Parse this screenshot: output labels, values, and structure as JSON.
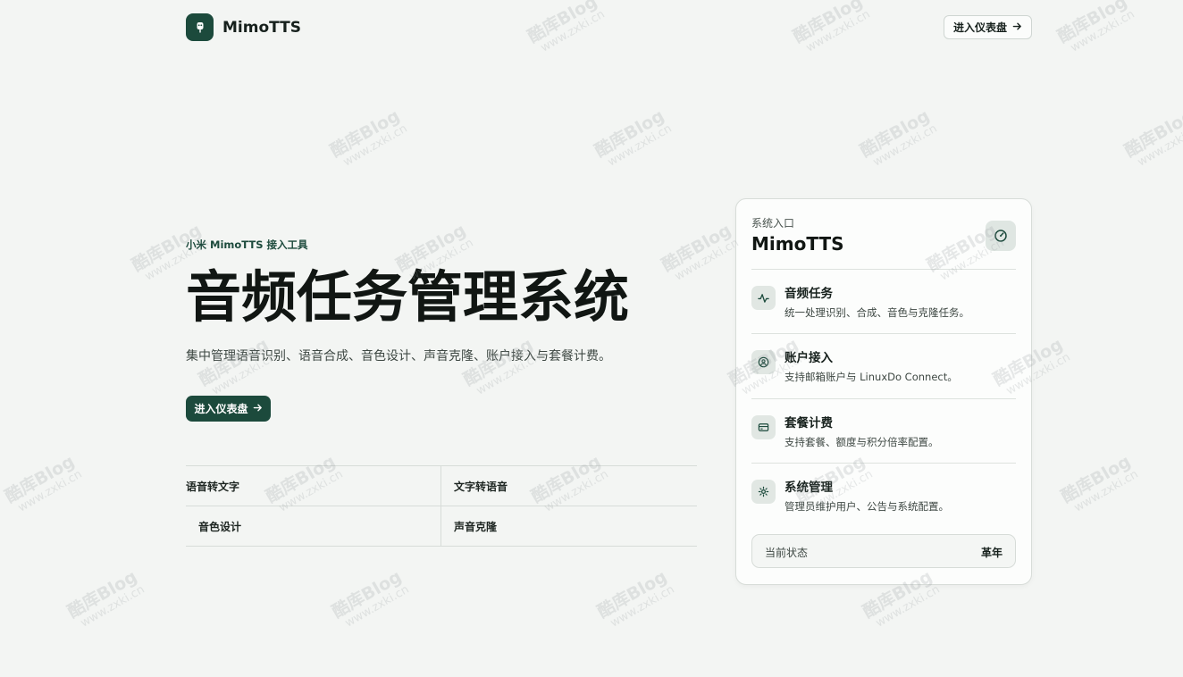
{
  "header": {
    "brand_name": "MimoTTS",
    "dashboard_label": "进入仪表盘",
    "dashboard_icon": "arrow-right-icon",
    "logo_icon": "mic-icon"
  },
  "hero": {
    "eyebrow": "小米 MimoTTS 接入工具",
    "title": "音频任务管理系统",
    "subtitle": "集中管理语音识别、语音合成、音色设计、声音克隆、账户接入与套餐计费。",
    "cta_label": "进入仪表盘"
  },
  "features": {
    "r1c1": "语音转文字",
    "r1c2": "文字转语音",
    "r2c1": "音色设计",
    "r2c2": "声音克隆"
  },
  "card": {
    "label": "系统入口",
    "title": "MimoTTS",
    "items": [
      {
        "title": "音频任务",
        "desc": "统一处理识别、合成、音色与克隆任务。",
        "icon": "waveform-icon"
      },
      {
        "title": "账户接入",
        "desc": "支持邮箱账户与 LinuxDo Connect。",
        "icon": "user-circle-icon"
      },
      {
        "title": "套餐计费",
        "desc": "支持套餐、额度与积分倍率配置。",
        "icon": "credit-card-icon"
      },
      {
        "title": "系统管理",
        "desc": "管理员维护用户、公告与系统配置。",
        "icon": "gear-icon"
      }
    ],
    "status_label": "当前状态",
    "status_value": "革年"
  },
  "watermark": {
    "line1": "酷库Blog",
    "line2": "www.zxki.cn"
  },
  "colors": {
    "accent": "#1c4a3c",
    "background": "#f3f5f3"
  }
}
